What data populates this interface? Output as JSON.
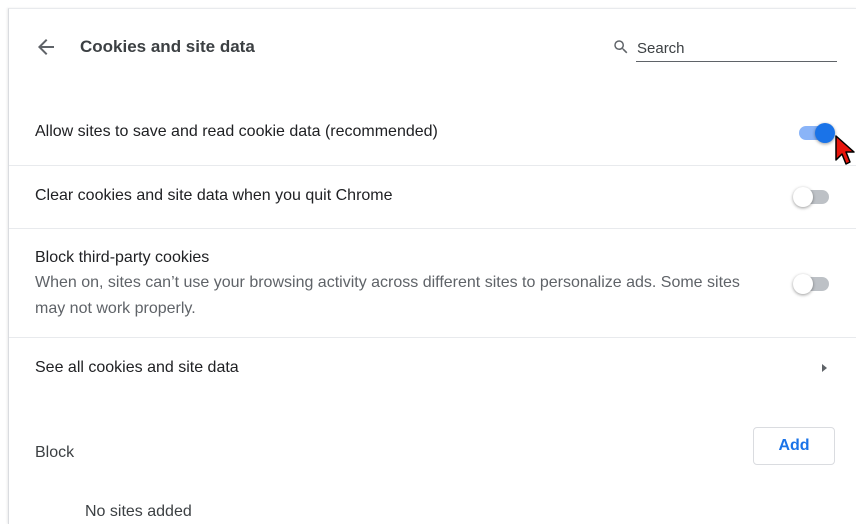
{
  "header": {
    "title": "Cookies and site data",
    "search_placeholder": "Search",
    "back_icon": "arrow-back-icon",
    "search_icon": "search-icon"
  },
  "settings": [
    {
      "label": "Allow sites to save and read cookie data (recommended)",
      "enabled": true
    },
    {
      "label": "Clear cookies and site data when you quit Chrome",
      "enabled": false
    },
    {
      "label": "Block third-party cookies",
      "description": "When on, sites can’t use your browsing activity across different sites to personalize ads. Some sites may not work properly.",
      "enabled": false
    }
  ],
  "see_all": {
    "label": "See all cookies and site data",
    "icon": "chevron-right-icon"
  },
  "block": {
    "label": "Block",
    "add_label": "Add",
    "empty_text": "No sites added"
  },
  "colors": {
    "accent": "#1a73e8",
    "toggle_on_track": "#8ab4f8",
    "toggle_off_track": "#bdc1c6",
    "cursor": "#e8150c"
  }
}
